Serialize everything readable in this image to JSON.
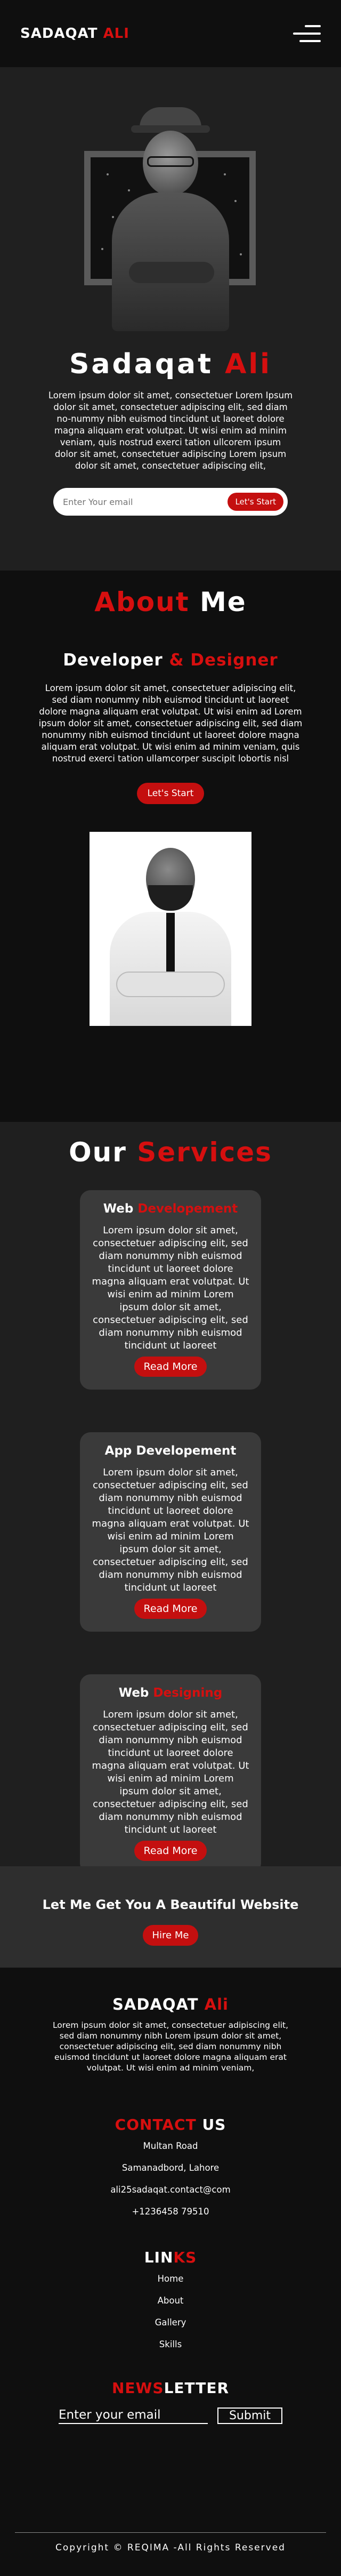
{
  "header": {
    "brand_part1": "SADAQAT",
    "brand_part2": "ALI",
    "menu_icon": "hamburger-menu-icon"
  },
  "hero": {
    "name_part1": "Sadaqat",
    "name_part2": "Ali",
    "text": "Lorem ipsum dolor sit amet, consectetuer Lorem Ipsum dolor sit amet, consectetuer adipiscing elit, sed diam no-nummy nibh euismod tincidunt ut laoreet dolore magna aliquam erat volutpat. Ut wisi enim ad minim veniam, quis nostrud exerci tation ullcorem ipsum dolor sit amet, consectetuer adipiscing Lorem ipsum dolor sit amet, consectetuer adipiscing elit,",
    "email_placeholder": "Enter Your email",
    "button": "Let's Start"
  },
  "about": {
    "title_part1": "About",
    "title_part2": "Me",
    "subtitle_part1": "Developer",
    "subtitle_part2": "& Designer",
    "text": "Lorem ipsum dolor sit amet, consectetuer adipiscing elit, sed diam nonummy nibh euismod tincidunt ut laoreet dolore magna aliquam erat volutpat. Ut wisi enim ad Lorem ipsum dolor sit amet, consectetuer adipiscing elit, sed diam nonummy nibh euismod tincidunt ut laoreet dolore magna aliquam erat volutpat. Ut wisi enim ad minim veniam, quis nostrud exerci tation ullamcorper suscipit lobortis nisl",
    "button": "Let's Start"
  },
  "services": {
    "title_part1": "Our",
    "title_part2": "Services",
    "items": [
      {
        "title_part1": "Web",
        "title_part2": "Developement",
        "text": "Lorem ipsum dolor sit amet, consectetuer adipiscing elit, sed diam nonummy nibh euismod tincidunt ut laoreet dolore magna aliquam erat volutpat. Ut wisi enim ad minim Lorem ipsum dolor sit amet, consectetuer adipiscing elit, sed diam nonummy nibh euismod tincidunt ut laoreet",
        "button": "Read More"
      },
      {
        "title_part1": "App Developement",
        "title_part2": "",
        "text": "Lorem ipsum dolor sit amet, consectetuer adipiscing elit, sed diam nonummy nibh euismod tincidunt ut laoreet dolore magna aliquam erat volutpat. Ut wisi enim ad minim Lorem ipsum dolor sit amet, consectetuer adipiscing elit, sed diam nonummy nibh euismod tincidunt ut laoreet",
        "button": "Read More"
      },
      {
        "title_part1": "Web",
        "title_part2": "Designing",
        "text": "Lorem ipsum dolor sit amet, consectetuer adipiscing elit, sed diam nonummy nibh euismod tincidunt ut laoreet dolore magna aliquam erat volutpat. Ut wisi enim ad minim Lorem ipsum dolor sit amet, consectetuer adipiscing elit, sed diam nonummy nibh euismod tincidunt ut laoreet",
        "button": "Read More"
      }
    ]
  },
  "cta": {
    "title": "Let Me Get You A Beautiful Website",
    "button": "Hire Me"
  },
  "footer": {
    "brand_part1": "SADAQAT",
    "brand_part2": "Ali",
    "desc": "Lorem ipsum dolor sit amet, consectetuer adipiscing elit, sed diam nonummy nibh Lorem ipsum dolor sit amet, consectetuer adipiscing elit, sed diam nonummy nibh euismod tincidunt ut laoreet dolore magna aliquam erat volutpat. Ut wisi enim ad minim veniam,",
    "contact_part1": "CONTACT",
    "contact_part2": "US",
    "contact_items": [
      "Multan Road",
      "Samanadbord, Lahore",
      "ali25sadaqat.contact@com",
      "+1236458 79510"
    ],
    "links_part1": "LIN",
    "links_part2": "KS",
    "links": [
      "Home",
      "About",
      "Gallery",
      "Skills"
    ],
    "newsletter_part1": "NEWS",
    "newsletter_part2": "LETTER",
    "newsletter_placeholder": "Enter your email",
    "newsletter_button": "Submit",
    "copyright": "Copyright © REQIMA -All Rights Reserved"
  },
  "colors": {
    "accent": "#d60f0f",
    "button": "#c40f0f",
    "dark": "#0f0f0f",
    "card": "#3a3a3a"
  }
}
